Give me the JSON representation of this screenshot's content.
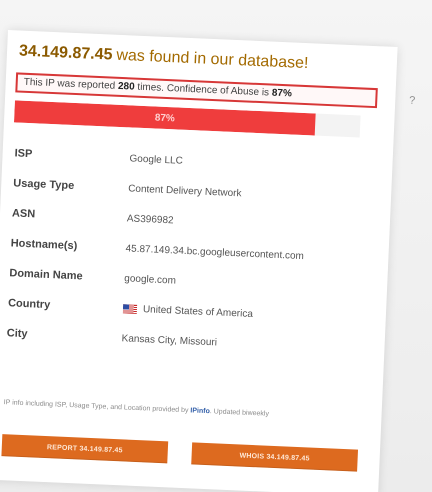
{
  "header": {
    "ip": "34.149.87.45",
    "found_text": "was found in our database!"
  },
  "notice": {
    "prefix": "This IP was reported",
    "count": "280",
    "middle": "times. Confidence of Abuse is",
    "confidence": "87%",
    "suffix": ""
  },
  "info_icon": "?",
  "progress": {
    "label": "87%",
    "value": 87
  },
  "details": [
    {
      "label": "ISP",
      "value": "Google LLC"
    },
    {
      "label": "Usage Type",
      "value": "Content Delivery Network"
    },
    {
      "label": "ASN",
      "value": "AS396982"
    },
    {
      "label": "Hostname(s)",
      "value": "45.87.149.34.bc.googleusercontent.com"
    },
    {
      "label": "Domain Name",
      "value": "google.com"
    },
    {
      "label": "Country",
      "value": "United States of America"
    },
    {
      "label": "City",
      "value": "Kansas City, Missouri"
    }
  ],
  "footnote": {
    "text_before": "IP info including ISP, Usage Type, and Location provided by",
    "provider": "IPinfo",
    "text_after": ". Updated biweekly"
  },
  "buttons": {
    "report": "REPORT 34.149.87.45",
    "whois": "WHOIS 34.149.87.45"
  },
  "icons": {
    "flag": "us-flag-icon"
  },
  "colors": {
    "accent": "#dd6a1f",
    "danger": "#ef3d3d",
    "link": "#315ea8"
  }
}
